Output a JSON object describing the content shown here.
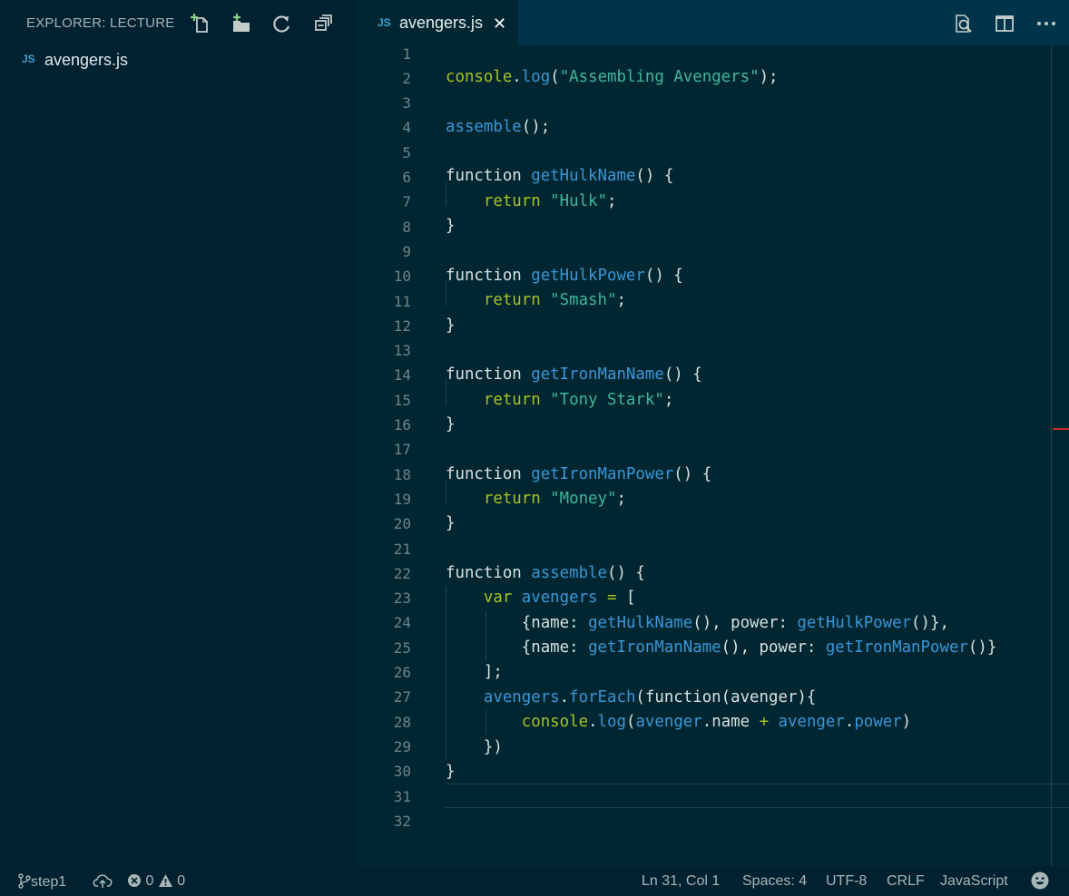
{
  "sidebar": {
    "title": "EXPLORER: LECTURE",
    "actions": [
      {
        "name": "new-file-icon"
      },
      {
        "name": "new-folder-icon"
      },
      {
        "name": "refresh-icon"
      },
      {
        "name": "collapse-all-icon"
      }
    ],
    "files": [
      {
        "badge": "JS",
        "name": "avengers.js"
      }
    ]
  },
  "tabs": [
    {
      "badge": "JS",
      "label": "avengers.js",
      "close": "✕",
      "active": true
    }
  ],
  "editor_actions": [
    "open-preview-icon",
    "split-editor-icon",
    "more-actions-icon"
  ],
  "editor": {
    "line_numbers": [
      "1",
      "2",
      "3",
      "4",
      "5",
      "6",
      "7",
      "8",
      "9",
      "10",
      "11",
      "12",
      "13",
      "14",
      "15",
      "16",
      "17",
      "18",
      "19",
      "20",
      "21",
      "22",
      "23",
      "24",
      "25",
      "26",
      "27",
      "28",
      "29",
      "30",
      "31",
      "32"
    ],
    "code": {
      "l2": {
        "a": "console",
        "b": ".",
        "c": "log",
        "d": "(",
        "e": "\"Assembling Avengers\"",
        "f": ");"
      },
      "l4": {
        "a": "assemble",
        "b": "();"
      },
      "l6": {
        "a": "function ",
        "b": "getHulkName",
        "c": "() {"
      },
      "l7": {
        "a": "    return ",
        "b": "\"Hulk\"",
        "c": ";"
      },
      "l8": {
        "a": "}"
      },
      "l10": {
        "a": "function ",
        "b": "getHulkPower",
        "c": "() {"
      },
      "l11": {
        "a": "    return ",
        "b": "\"Smash\"",
        "c": ";"
      },
      "l12": {
        "a": "}"
      },
      "l14": {
        "a": "function ",
        "b": "getIronManName",
        "c": "() {"
      },
      "l15": {
        "a": "    return ",
        "b": "\"Tony Stark\"",
        "c": ";"
      },
      "l16": {
        "a": "}"
      },
      "l18": {
        "a": "function ",
        "b": "getIronManPower",
        "c": "() {"
      },
      "l19": {
        "a": "    return ",
        "b": "\"Money\"",
        "c": ";"
      },
      "l20": {
        "a": "}"
      },
      "l22": {
        "a": "function ",
        "b": "assemble",
        "c": "() {"
      },
      "l23": {
        "a": "    var ",
        "b": "avengers",
        "c": " = ",
        "d": "["
      },
      "l24": {
        "a": "        {name: ",
        "b": "getHulkName",
        "c": "(), power: ",
        "d": "getHulkPower",
        "e": "()},"
      },
      "l25": {
        "a": "        {name: ",
        "b": "getIronManName",
        "c": "(), power: ",
        "d": "getIronManPower",
        "e": "()}"
      },
      "l26": {
        "a": "    ];"
      },
      "l27": {
        "a": "    avengers",
        "b": ".",
        "c": "forEach",
        "d": "(function(avenger){"
      },
      "l28": {
        "a": "        console",
        "b": ".",
        "c": "log",
        "d": "(",
        "e": "avenger",
        "f": ".name ",
        "g": "+",
        "h": " avenger",
        "i": ".",
        "j": "power",
        "k": ")"
      },
      "l29": {
        "a": "    })"
      },
      "l30": {
        "a": "}"
      }
    }
  },
  "status": {
    "branch": "step1",
    "errors": "0",
    "warnings": "0",
    "position": "Ln 31, Col 1",
    "spaces": "Spaces: 4",
    "encoding": "UTF-8",
    "eol": "CRLF",
    "language": "JavaScript"
  },
  "colors": {
    "editor_bg": "#002731",
    "sidebar_bg": "#002130",
    "tabbar_bg": "#00344a",
    "function_blue": "#3b95d6",
    "string_teal": "#41b69a",
    "keyword_green": "#a8c023"
  }
}
